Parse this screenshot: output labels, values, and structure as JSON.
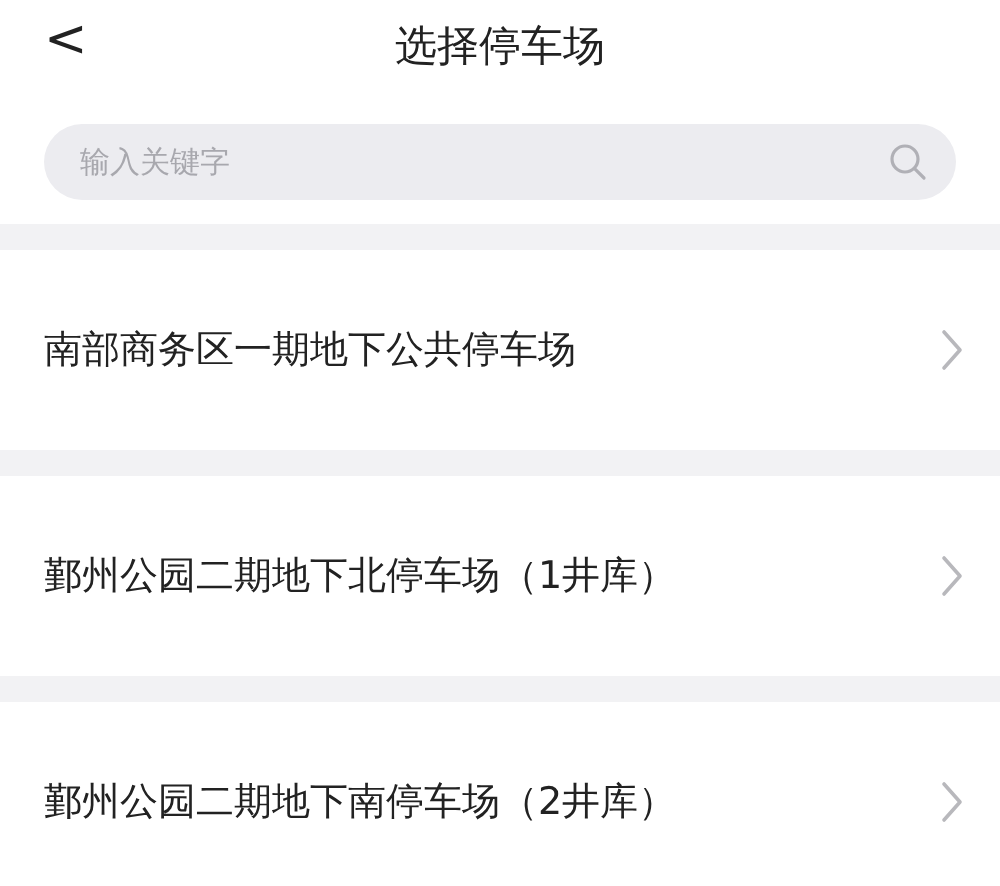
{
  "header": {
    "back": "<",
    "title": "选择停车场"
  },
  "search": {
    "placeholder": "输入关键字"
  },
  "parking_lots": [
    {
      "name": "南部商务区一期地下公共停车场"
    },
    {
      "name": "鄞州公园二期地下北停车场（1井库）"
    },
    {
      "name": "鄞州公园二期地下南停车场（2井库）"
    }
  ]
}
